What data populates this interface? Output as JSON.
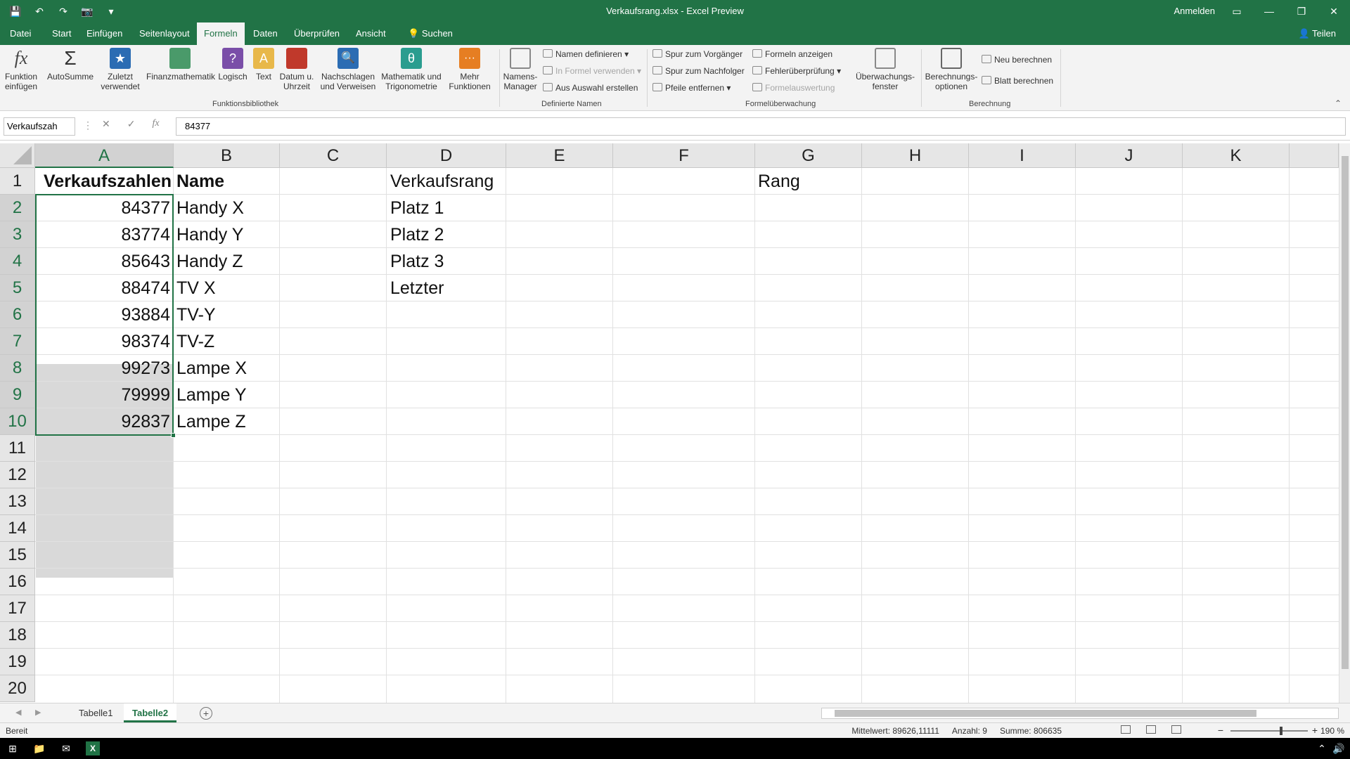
{
  "window": {
    "title": "Verkaufsrang.xlsx  -  Excel Preview",
    "sign_in": "Anmelden"
  },
  "ribbon_tabs": [
    "Datei",
    "Start",
    "Einfügen",
    "Seitenlayout",
    "Formeln",
    "Daten",
    "Überprüfen",
    "Ansicht",
    "Suchen"
  ],
  "active_tab": "Formeln",
  "share": "Teilen",
  "ribbon": {
    "funktionsbibliothek": {
      "label": "Funktionsbibliothek",
      "buttons": [
        "Funktion einfügen",
        "AutoSumme",
        "Zuletzt verwendet",
        "Finanzmathematik",
        "Logisch",
        "Text",
        "Datum u. Uhrzeit",
        "Nachschlagen und Verweisen",
        "Mathematik und Trigonometrie",
        "Mehr Funktionen"
      ]
    },
    "definierte_namen": {
      "label": "Definierte Namen",
      "manager": "Namens-Manager",
      "items": [
        "Namen definieren",
        "In Formel verwenden",
        "Aus Auswahl erstellen"
      ]
    },
    "formelueberwachung": {
      "label": "Formelüberwachung",
      "items": [
        "Spur zum Vorgänger",
        "Spur zum Nachfolger",
        "Pfeile entfernen",
        "Formeln anzeigen",
        "Fehlerüberprüfung",
        "Formelauswertung"
      ],
      "watch": "Überwachungs-fenster"
    },
    "berechnung": {
      "label": "Berechnung",
      "options": "Berechnungs-optionen",
      "items": [
        "Neu berechnen",
        "Blatt berechnen"
      ]
    }
  },
  "formula_bar": {
    "name_box": "Verkaufszah",
    "formula": "84377"
  },
  "columns": [
    "A",
    "B",
    "C",
    "D",
    "E",
    "F",
    "G",
    "H",
    "I",
    "J",
    "K"
  ],
  "rows": [
    "1",
    "2",
    "3",
    "4",
    "5",
    "6",
    "7",
    "8",
    "9",
    "10",
    "11",
    "12",
    "13",
    "14",
    "15",
    "16",
    "17",
    "18",
    "19",
    "20"
  ],
  "cells": {
    "A1": "Verkaufszahlen",
    "B1": "Name",
    "D1": "Verkaufsrang",
    "G1": "Rang",
    "A2": "84377",
    "B2": "Handy X",
    "D2": "Platz 1",
    "A3": "83774",
    "B3": "Handy Y",
    "D3": "Platz 2",
    "A4": "85643",
    "B4": "Handy Z",
    "D4": "Platz 3",
    "A5": "88474",
    "B5": "TV X",
    "D5": "Letzter",
    "A6": "93884",
    "B6": "TV-Y",
    "A7": "98374",
    "B7": "TV-Z",
    "A8": "99273",
    "B8": "Lampe X",
    "A9": "79999",
    "B9": "Lampe Y",
    "A10": "92837",
    "B10": "Lampe Z"
  },
  "sheets": [
    "Tabelle1",
    "Tabelle2"
  ],
  "active_sheet": "Tabelle2",
  "status": {
    "mode": "Bereit",
    "average": "Mittelwert: 89626,11111",
    "count": "Anzahl: 9",
    "sum": "Summe: 806635",
    "zoom": "190 %"
  },
  "colors": {
    "excel_green": "#217346",
    "selection_gray": "#d9d9d9"
  }
}
